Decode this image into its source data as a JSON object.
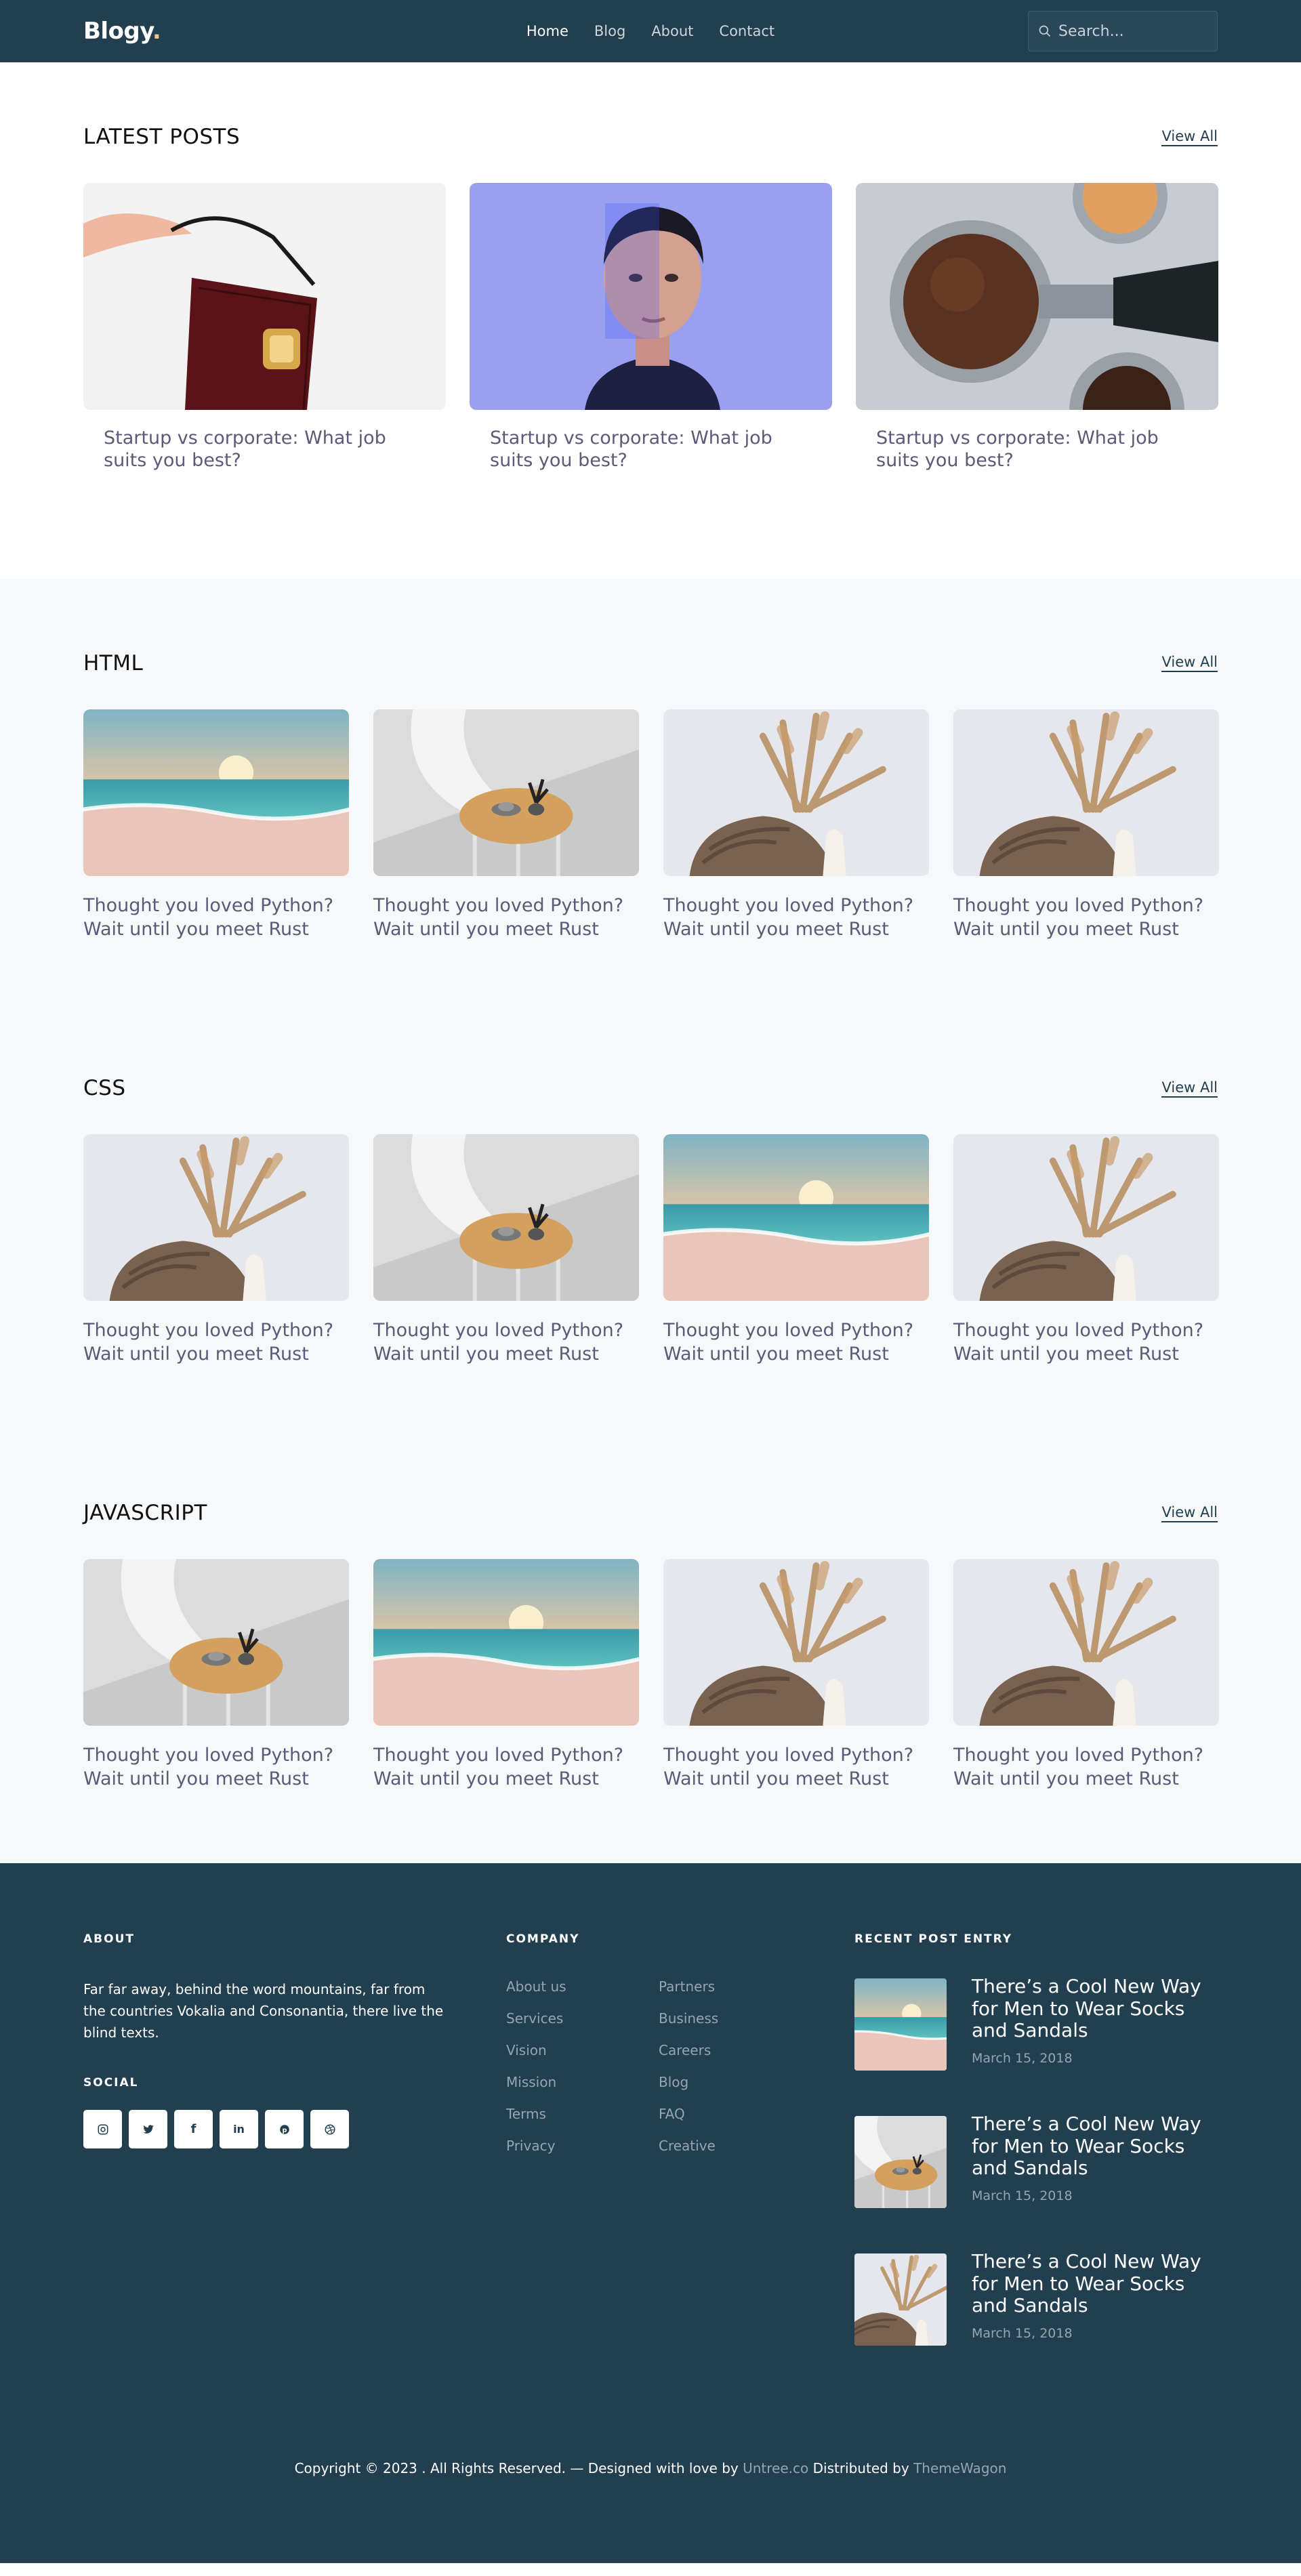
{
  "header": {
    "logo": "Blogy",
    "logo_dot": ".",
    "nav": [
      "Home",
      "Blog",
      "About",
      "Contact"
    ],
    "search_placeholder": "Search..."
  },
  "latest": {
    "title": "LATEST POSTS",
    "view_all": "View All",
    "posts": [
      {
        "title": "Startup vs corporate: What job suits you best?",
        "image": "handbag"
      },
      {
        "title": "Startup vs corporate: What job suits you best?",
        "image": "portrait"
      },
      {
        "title": "Startup vs corporate: What job suits you best?",
        "image": "coffee"
      }
    ]
  },
  "categories": [
    {
      "title": "HTML",
      "view_all": "View All",
      "posts": [
        {
          "title": "Thought you loved Python? Wait until you meet Rust",
          "image": "beach"
        },
        {
          "title": "Thought you loved Python? Wait until you meet Rust",
          "image": "table"
        },
        {
          "title": "Thought you loved Python? Wait until you meet Rust",
          "image": "pampas"
        },
        {
          "title": "Thought you loved Python? Wait until you meet Rust",
          "image": "pampas"
        }
      ]
    },
    {
      "title": "CSS",
      "view_all": "View All",
      "posts": [
        {
          "title": "Thought you loved Python? Wait until you meet Rust",
          "image": "pampas"
        },
        {
          "title": "Thought you loved Python? Wait until you meet Rust",
          "image": "table"
        },
        {
          "title": "Thought you loved Python? Wait until you meet Rust",
          "image": "beach"
        },
        {
          "title": "Thought you loved Python? Wait until you meet Rust",
          "image": "pampas"
        }
      ]
    },
    {
      "title": "JAVASCRIPT",
      "view_all": "View All",
      "posts": [
        {
          "title": "Thought you loved Python? Wait until you meet Rust",
          "image": "table"
        },
        {
          "title": "Thought you loved Python? Wait until you meet Rust",
          "image": "beach"
        },
        {
          "title": "Thought you loved Python? Wait until you meet Rust",
          "image": "pampas"
        },
        {
          "title": "Thought you loved Python? Wait until you meet Rust",
          "image": "pampas"
        }
      ]
    }
  ],
  "footer": {
    "about_title": "ABOUT",
    "about_text": "Far far away, behind the word mountains, far from the countries Vokalia and Consonantia, there live the blind texts.",
    "social_title": "SOCIAL",
    "socials": [
      "instagram-icon",
      "twitter-icon",
      "facebook-icon",
      "linkedin-icon",
      "pinterest-icon",
      "dribbble-icon"
    ],
    "company_title": "COMPANY",
    "company_links": [
      "About us",
      "Partners",
      "Services",
      "Business",
      "Vision",
      "Careers",
      "Mission",
      "Blog",
      "Terms",
      "FAQ",
      "Privacy",
      "Creative"
    ],
    "recent_title": "RECENT POST ENTRY",
    "recent": [
      {
        "title": "There’s a Cool New Way for Men to Wear Socks and Sandals",
        "date": "March 15, 2018",
        "image": "beach"
      },
      {
        "title": "There’s a Cool New Way for Men to Wear Socks and Sandals",
        "date": "March 15, 2018",
        "image": "table"
      },
      {
        "title": "There’s a Cool New Way for Men to Wear Socks and Sandals",
        "date": "March 15, 2018",
        "image": "pampas"
      }
    ],
    "copyright_pre": "Copyright © 2023 . All Rights Reserved. — Designed with love by ",
    "copyright_link1": "Untree.co",
    "copyright_mid": " Distributed by ",
    "copyright_link2": "ThemeWagon"
  },
  "colors": {
    "header_bg": "#223f50",
    "title_text": "#5b5b78",
    "muted_link": "#95a5b1"
  }
}
